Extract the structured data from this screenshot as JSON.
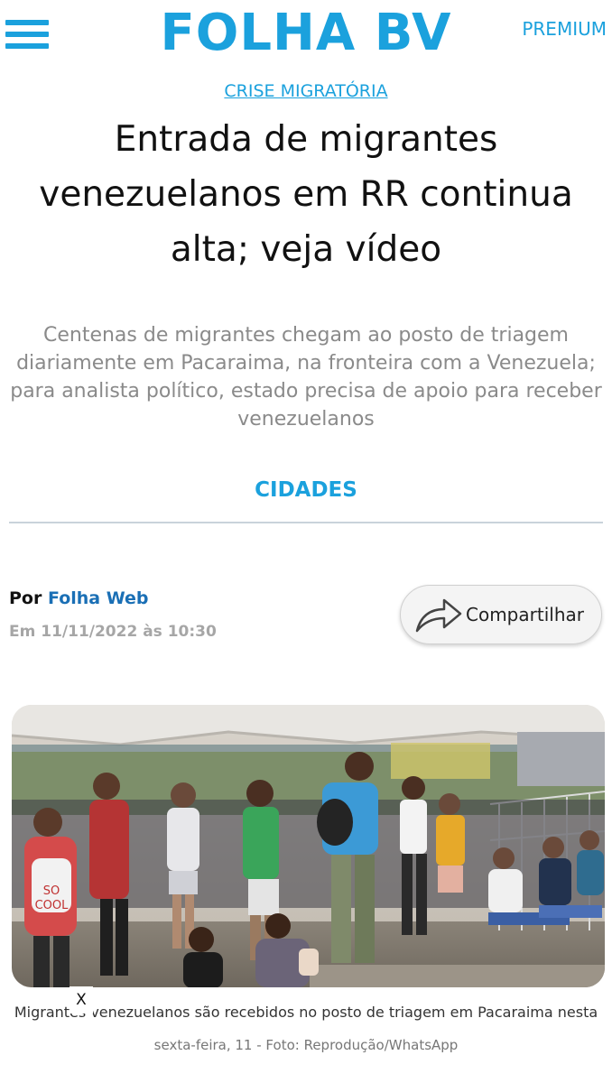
{
  "header": {
    "logo": "FOLHA BV",
    "premium_label": "PREMIUM",
    "brand_color": "#1ba1dd"
  },
  "article": {
    "kicker": "CRISE MIGRATÓRIA",
    "headline": "Entrada de migrantes venezuelanos em RR continua alta; veja vídeo",
    "subheadline": "Centenas de migrantes chegam ao posto de triagem diariamente em Pacaraima, na fronteira com a Venezuela; para analista político, estado precisa de apoio para receber venezuelanos",
    "section": "CIDADES",
    "byline_prefix": "Por",
    "author": "Folha Web",
    "date": "Em 11/11/2022 às 10:30",
    "share_label": "Compartilhar",
    "share_icon": "share-arrow-icon",
    "photo": {
      "caption": "Migrantes venezuelanos são recebidos no posto de triagem em Pacaraima nesta",
      "credit": "sexta-feira, 11 - Foto: Reprodução/WhatsApp",
      "shirt_text_1": "SO",
      "shirt_text_2": "COOL"
    }
  },
  "ad_close_label": "X"
}
